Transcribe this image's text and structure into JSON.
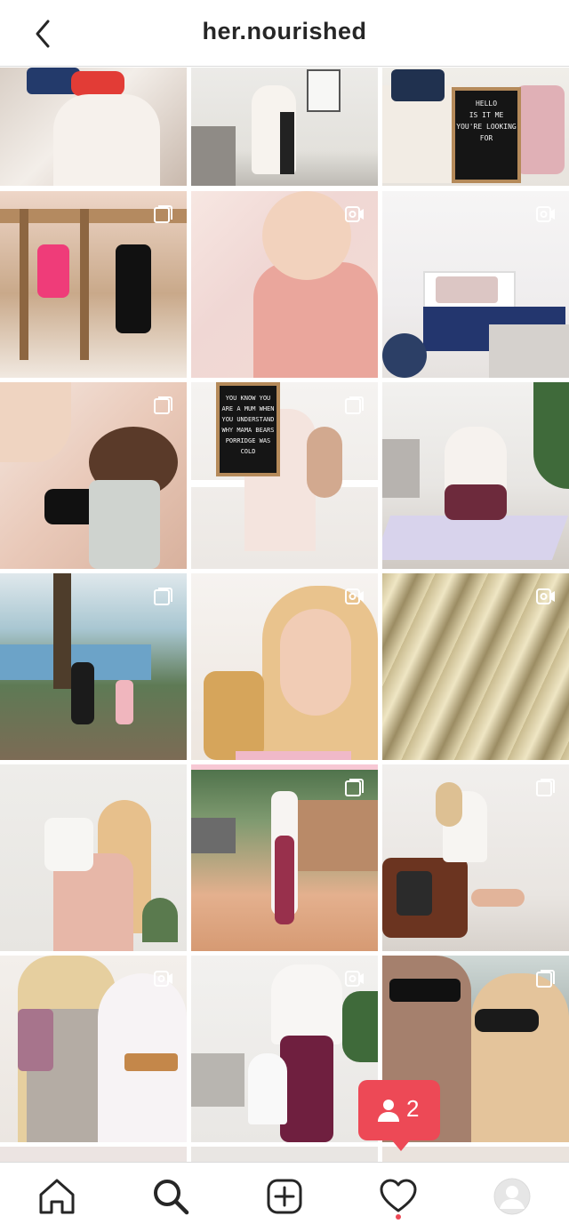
{
  "header": {
    "title": "her.nourished",
    "back_icon": "chevron-left-icon"
  },
  "letterboard_1": [
    "HELLO",
    "IS IT ME",
    "YOU'RE LOOKING",
    "FOR"
  ],
  "letterboard_2": [
    "YOU KNOW YOU",
    "ARE A MUM WHEN",
    "YOU UNDERSTAND",
    "WHY MAMA BEARS",
    "PORRIDGE WAS",
    "COLD"
  ],
  "activity": {
    "icon": "person-icon",
    "count": "2",
    "color": "#ed4956"
  },
  "bottom_nav": {
    "items": [
      {
        "name": "home",
        "icon": "home-icon"
      },
      {
        "name": "search",
        "icon": "search-icon",
        "active": true
      },
      {
        "name": "new-post",
        "icon": "plus-square-icon"
      },
      {
        "name": "activity",
        "icon": "heart-icon",
        "has_indicator": true
      },
      {
        "name": "profile",
        "icon": "avatar-icon"
      }
    ]
  }
}
